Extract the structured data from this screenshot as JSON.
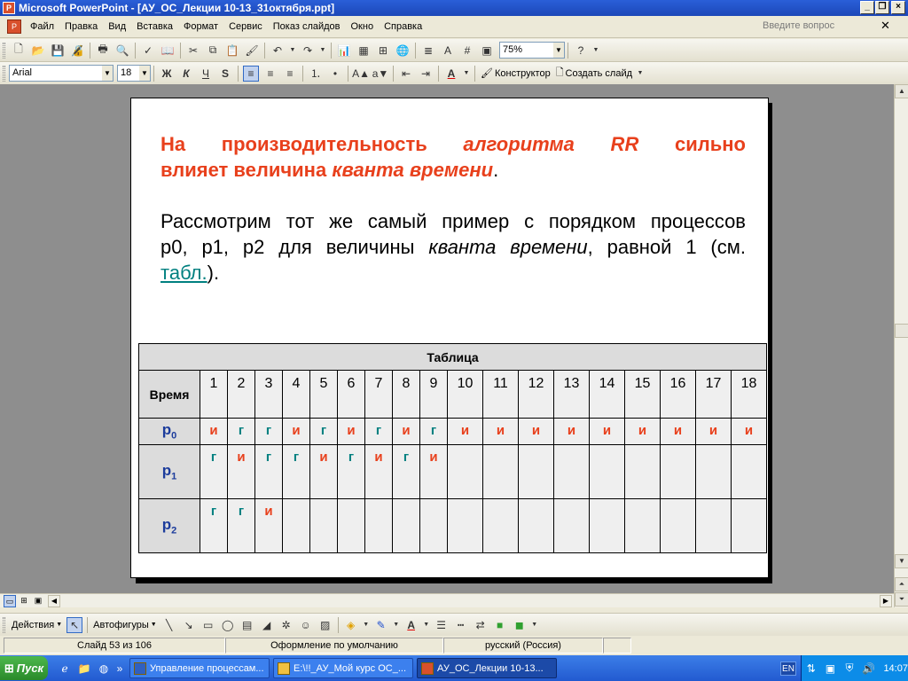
{
  "window": {
    "title": "Microsoft PowerPoint - [АУ_ОС_Лекции 10-13_31октября.ppt]"
  },
  "menu": {
    "items": [
      "Файл",
      "Правка",
      "Вид",
      "Вставка",
      "Формат",
      "Сервис",
      "Показ слайдов",
      "Окно",
      "Справка"
    ],
    "help_placeholder": "Введите вопрос"
  },
  "toolbar": {
    "zoom": "75%",
    "font": "Arial",
    "size": "18",
    "designer": "Конструктор",
    "new_slide": "Создать слайд"
  },
  "slide": {
    "heading": {
      "line1": [
        "На производительность ",
        "алгоритма RR",
        " сильно"
      ],
      "line2": [
        "влияет величина ",
        "кванта времени",
        "."
      ]
    },
    "body": {
      "line1": "Рассмотрим тот же самый пример с порядком процессов",
      "line2": [
        "p0, p1, p2 для величины ",
        "кванта времени",
        ", равной 1 (см."
      ],
      "line3": [
        "табл.",
        ")."
      ]
    },
    "table": {
      "caption": "Таблица",
      "time_label": "Время",
      "times": [
        "1",
        "2",
        "3",
        "4",
        "5",
        "6",
        "7",
        "8",
        "9",
        "10",
        "11",
        "12",
        "13",
        "14",
        "15",
        "16",
        "17",
        "18"
      ],
      "rows": [
        {
          "proc": "p",
          "sub": "0",
          "cells": [
            "и",
            "г",
            "г",
            "и",
            "г",
            "и",
            "г",
            "и",
            "г",
            "и",
            "и",
            "и",
            "и",
            "и",
            "и",
            "и",
            "и",
            "и"
          ]
        },
        {
          "proc": "p",
          "sub": "1",
          "cells": [
            "г",
            "и",
            "г",
            "г",
            "и",
            "г",
            "и",
            "г",
            "и",
            "",
            "",
            "",
            "",
            "",
            "",
            "",
            "",
            ""
          ]
        },
        {
          "proc": "p",
          "sub": "2",
          "cells": [
            "г",
            "г",
            "и",
            "",
            "",
            "",
            "",
            "",
            "",
            "",
            "",
            "",
            "",
            "",
            "",
            "",
            "",
            ""
          ]
        }
      ]
    }
  },
  "drawing_toolbar": {
    "actions": "Действия",
    "autoshapes": "Автофигуры"
  },
  "status": {
    "slide": "Слайд 53 из 106",
    "design": "Оформление по умолчанию",
    "lang": "русский (Россия)"
  },
  "taskbar": {
    "start": "Пуск",
    "tasks": [
      "Управление процессам...",
      "E:\\!!_АУ_Мой курс ОС_...",
      "АУ_ОС_Лекции 10-13..."
    ],
    "lang": "EN",
    "clock": "14:07"
  },
  "colors": {
    "accent_red": "#e8401c",
    "teal": "#008080",
    "proc_blue": "#1c3c9c"
  }
}
